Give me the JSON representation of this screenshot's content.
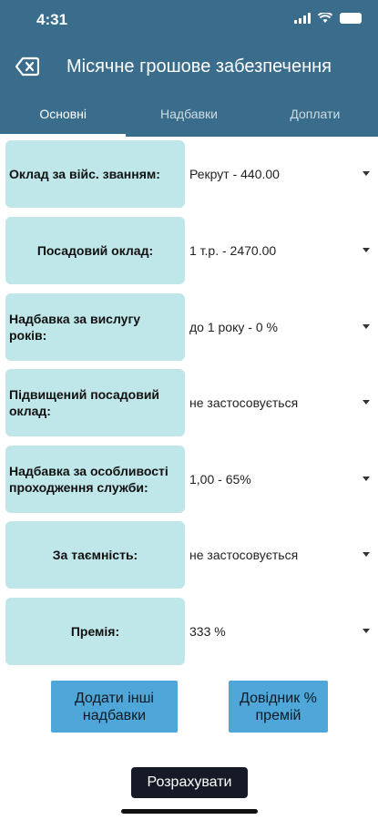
{
  "status": {
    "time": "4:31"
  },
  "appbar": {
    "title": "Місячне грошове забезпечення"
  },
  "tabs": [
    {
      "label": "Основні"
    },
    {
      "label": "Надбавки"
    },
    {
      "label": "Доплати"
    }
  ],
  "rows": [
    {
      "label": "Оклад за війс. званням:",
      "value": "Рекрут - 440.00"
    },
    {
      "label": "Посадовий оклад:",
      "value": "1 т.р. - 2470.00"
    },
    {
      "label": "Надбавка за вислугу років:",
      "value": "до 1 року - 0 %"
    },
    {
      "label": "Підвищений посадовий оклад:",
      "value": "не застосовується"
    },
    {
      "label": "Надбавка за особливості проходження служби:",
      "value": "1,00 - 65%"
    },
    {
      "label": "За таємність:",
      "value": "не застосовується"
    },
    {
      "label": "Премія:",
      "value": "333 %"
    }
  ],
  "buttons": {
    "add_allowances": "Додати інші надбавки",
    "premium_guide": "Довідник % премій",
    "calculate": "Розрахувати"
  },
  "colors": {
    "header": "#3a6d8c",
    "label_bg": "#bfe6e8",
    "button": "#4fa6d8",
    "calc": "#161a26"
  }
}
